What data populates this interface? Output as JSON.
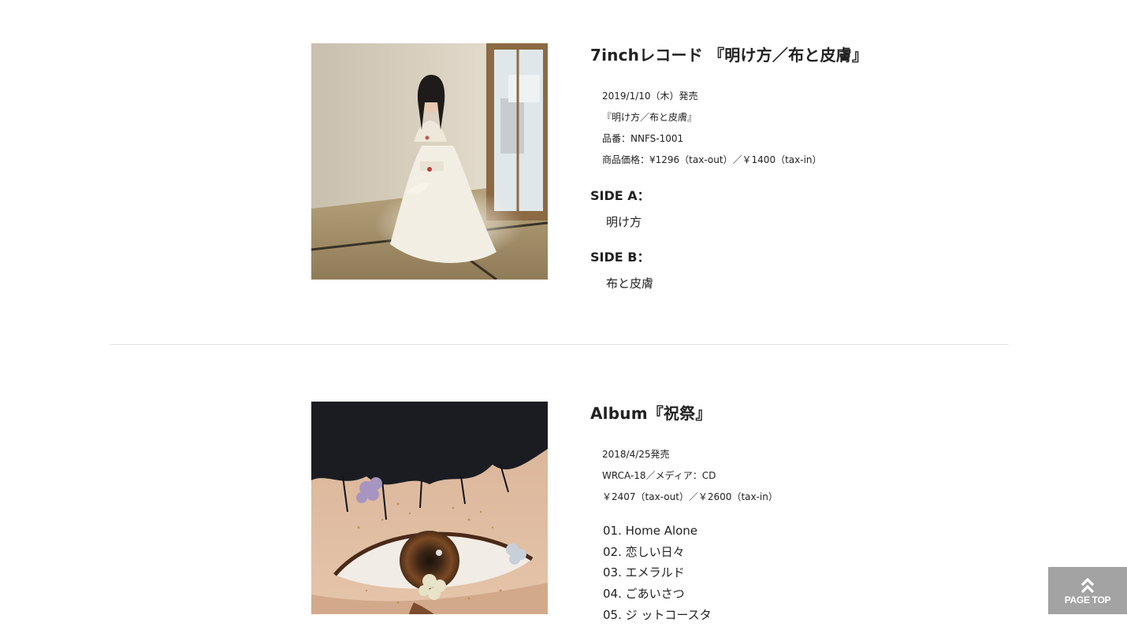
{
  "release1": {
    "title": "7inchレコード 『明け方／布と皮膚』",
    "meta": [
      "2019/1/10（木）発売",
      "『明け方／布と皮膚』",
      "品番：NNFS-1001",
      "商品価格：¥1296（tax-out）／￥1400（tax-in）"
    ],
    "side_a_label": "SIDE A：",
    "side_a_track": "明け方",
    "side_b_label": "SIDE B：",
    "side_b_track": "布と皮膚"
  },
  "release2": {
    "title": "Album『祝祭』",
    "meta": [
      "2018/4/25発売",
      "WRCA-18／メディア：CD",
      "￥2407（tax-out）／￥2600（tax-in）"
    ],
    "tracks": [
      "01. Home Alone",
      "02. 恋しい日々",
      "03. エメラルド",
      "04. ごあいさつ",
      "05. ジ ットコースタ"
    ]
  },
  "page_top": {
    "label": "PAGE TOP",
    "icon": "double-chevron-up-icon"
  },
  "colors": {
    "text": "#222222",
    "divider": "#e2e2e2",
    "page_top_bg": "#a3a3a3"
  }
}
